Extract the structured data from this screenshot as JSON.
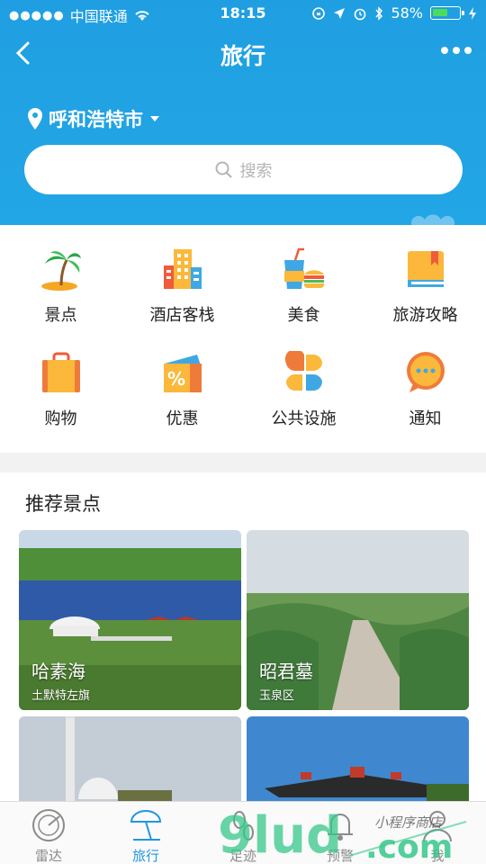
{
  "status_bar": {
    "signal": "●●●●●",
    "carrier": "中国联通",
    "time": "18:15",
    "battery_percent": "58%",
    "battery_level": 0.58
  },
  "nav": {
    "title": "旅行"
  },
  "location": {
    "city": "呼和浩特市"
  },
  "search": {
    "placeholder": "搜索"
  },
  "categories": [
    {
      "label": "景点",
      "icon": "palm-tree-icon"
    },
    {
      "label": "酒店客栈",
      "icon": "hotel-icon"
    },
    {
      "label": "美食",
      "icon": "food-icon"
    },
    {
      "label": "旅游攻略",
      "icon": "guide-book-icon"
    },
    {
      "label": "购物",
      "icon": "shopping-bag-icon"
    },
    {
      "label": "优惠",
      "icon": "coupon-icon"
    },
    {
      "label": "公共设施",
      "icon": "facilities-icon"
    },
    {
      "label": "通知",
      "icon": "notice-bubble-icon"
    }
  ],
  "recommend": {
    "title": "推荐景点",
    "items": [
      {
        "name": "哈素海",
        "district": "土默特左旗"
      },
      {
        "name": "昭君墓",
        "district": "玉泉区"
      },
      {
        "name": "",
        "district": ""
      },
      {
        "name": "",
        "district": ""
      }
    ]
  },
  "tabs": [
    {
      "label": "雷达",
      "icon": "radar-icon"
    },
    {
      "label": "旅行",
      "icon": "beach-umbrella-icon"
    },
    {
      "label": "足迹",
      "icon": "footprint-icon"
    },
    {
      "label": "预警",
      "icon": "bell-icon"
    },
    {
      "label": "我",
      "icon": "user-icon"
    }
  ],
  "watermark": {
    "text_top": "小程序商店",
    "text_bottom": "9lud.com"
  },
  "colors": {
    "primary": "#23a6e6",
    "active_tab": "#2196e0",
    "inactive_tab": "#8a8a8a"
  }
}
